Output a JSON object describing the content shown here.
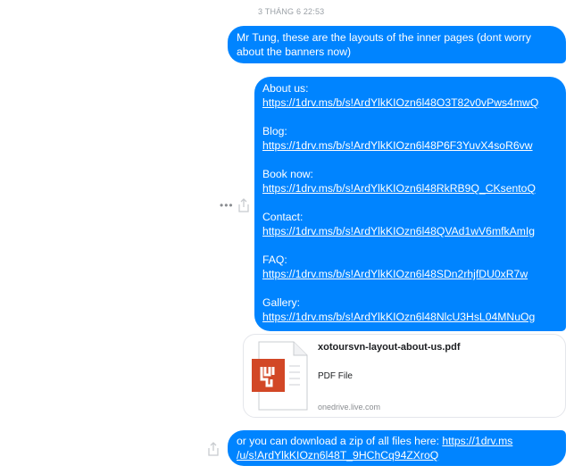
{
  "timestamp": "3 THÁNG 6 22:53",
  "messages": {
    "first": "Mr Tung, these are the layouts of the inner pages (dont worry about the banners now)",
    "links": [
      {
        "label": "About us:",
        "url": "https://1drv.ms/b/s!ArdYlkKIOzn6l48O3T82v0vPws4mwQ"
      },
      {
        "label": "Blog:",
        "url": "https://1drv.ms/b/s!ArdYlkKIOzn6l48P6F3YuvX4soR6vw"
      },
      {
        "label": "Book now:",
        "url": "https://1drv.ms/b/s!ArdYlkKIOzn6l48RkRB9Q_CKsentoQ"
      },
      {
        "label": "Contact:",
        "url": "https://1drv.ms/b/s!ArdYlkKIOzn6l48QVAd1wV6mfkAmIg"
      },
      {
        "label": "FAQ:",
        "url": "https://1drv.ms/b/s!ArdYlkKIOzn6l48SDn2rhjfDU0xR7w"
      },
      {
        "label": "Gallery:",
        "url": "https://1drv.ms/b/s!ArdYlkKIOzn6l48NlcU3HsL04MNuOg"
      }
    ],
    "last_prefix": "or you can download a zip of all files here: ",
    "last_link_line1": "https://1drv.ms",
    "last_link_line2": "/u/s!ArdYlkKIOzn6l48T_9HChCq94ZXroQ"
  },
  "attachment": {
    "title": "xotoursvn-layout-about-us.pdf",
    "type": "PDF File",
    "domain": "onedrive.live.com",
    "icon": "pdf-document-icon",
    "icon_color": "#d24726"
  },
  "icons": {
    "more": "more-options-icon",
    "share": "share-icon"
  }
}
